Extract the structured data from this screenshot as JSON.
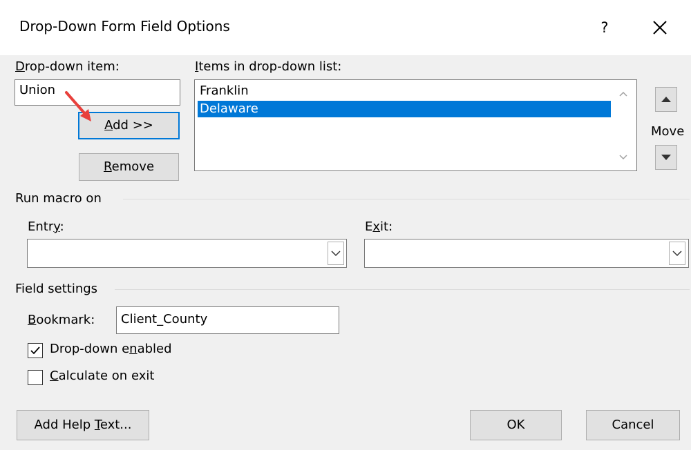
{
  "window": {
    "title": "Drop-Down Form Field Options",
    "help_label": "?",
    "close_icon": "close-icon"
  },
  "dropdown_item": {
    "label_accel": "D",
    "label_rest": "rop-down item:",
    "value": "Union"
  },
  "buttons": {
    "add_accel": "A",
    "add_rest": "dd >>",
    "remove_accel": "R",
    "remove_rest": "emove",
    "help_text_pre": "Add Help ",
    "help_text_accel": "T",
    "help_text_post": "ext...",
    "ok": "OK",
    "cancel": "Cancel"
  },
  "items_list": {
    "label_accel": "I",
    "label_rest": "tems in drop-down list:",
    "items": [
      {
        "text": "Franklin",
        "selected": false
      },
      {
        "text": "Delaware",
        "selected": true
      }
    ]
  },
  "move": {
    "label": "Move",
    "up_icon": "triangle-up-icon",
    "down_icon": "triangle-down-icon"
  },
  "run_macro": {
    "heading": "Run macro on",
    "entry_pre": "Entr",
    "entry_accel": "y",
    "entry_post": ":",
    "entry_value": "",
    "exit_pre": "E",
    "exit_accel": "x",
    "exit_post": "it:",
    "exit_value": ""
  },
  "field_settings": {
    "heading": "Field settings",
    "bookmark_accel": "B",
    "bookmark_rest": "ookmark:",
    "bookmark_value": "Client_County",
    "dropdown_enabled_pre": "Drop-down e",
    "dropdown_enabled_accel": "n",
    "dropdown_enabled_post": "abled",
    "dropdown_enabled_checked": true,
    "calculate_accel": "C",
    "calculate_rest": "alculate on exit",
    "calculate_checked": false
  },
  "colors": {
    "accent": "#0078d7",
    "annotation_arrow": "#e8403c"
  }
}
